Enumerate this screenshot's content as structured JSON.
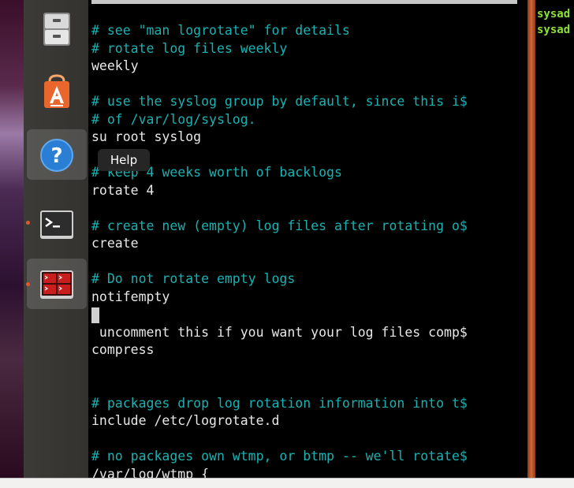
{
  "launcher": {
    "items": [
      {
        "name": "Files",
        "icon": "file-cabinet-icon"
      },
      {
        "name": "Ubuntu Software",
        "icon": "software-center-icon"
      },
      {
        "name": "Help",
        "icon": "help-icon"
      },
      {
        "name": "Terminal",
        "icon": "terminal-icon"
      },
      {
        "name": "Workspace Switcher",
        "icon": "workspace-switcher-icon"
      }
    ],
    "tooltip": "Help"
  },
  "editor": {
    "lines": [
      {
        "text": "# see \"man logrotate\" for details",
        "type": "comment"
      },
      {
        "text": "# rotate log files weekly",
        "type": "comment"
      },
      {
        "text": "weekly",
        "type": "code"
      },
      {
        "text": "",
        "type": "blank"
      },
      {
        "text": "# use the syslog group by default, since this i$",
        "type": "comment"
      },
      {
        "text": "# of /var/log/syslog.",
        "type": "comment"
      },
      {
        "text": "su root syslog",
        "type": "code"
      },
      {
        "text": "",
        "type": "blank"
      },
      {
        "text": "# keep 4 weeks worth of backlogs",
        "type": "comment"
      },
      {
        "text": "rotate 4",
        "type": "code"
      },
      {
        "text": "",
        "type": "blank"
      },
      {
        "text": "# create new (empty) log files after rotating o$",
        "type": "comment"
      },
      {
        "text": "create",
        "type": "code"
      },
      {
        "text": "",
        "type": "blank"
      },
      {
        "text": "# Do not rotate empty logs",
        "type": "comment"
      },
      {
        "text": "notifempty",
        "type": "code"
      },
      {
        "text": "",
        "type": "cursor"
      },
      {
        "text": " uncomment this if you want your log files comp$",
        "type": "code"
      },
      {
        "text": "compress",
        "type": "code"
      },
      {
        "text": "",
        "type": "blank"
      },
      {
        "text": "",
        "type": "blank"
      },
      {
        "text": "# packages drop log rotation information into t$",
        "type": "comment"
      },
      {
        "text": "include /etc/logrotate.d",
        "type": "code"
      },
      {
        "text": "",
        "type": "blank"
      },
      {
        "text": "# no packages own wtmp, or btmp -- we'll rotate$",
        "type": "comment"
      },
      {
        "text": "/var/log/wtmp {",
        "type": "code"
      }
    ]
  },
  "right_terminal": {
    "lines": [
      "sysad",
      "sysad"
    ]
  },
  "colors": {
    "comment": "#18b2b2",
    "code": "#e8e8e8",
    "prompt": "#8ae234",
    "accent": "#e9542a"
  }
}
